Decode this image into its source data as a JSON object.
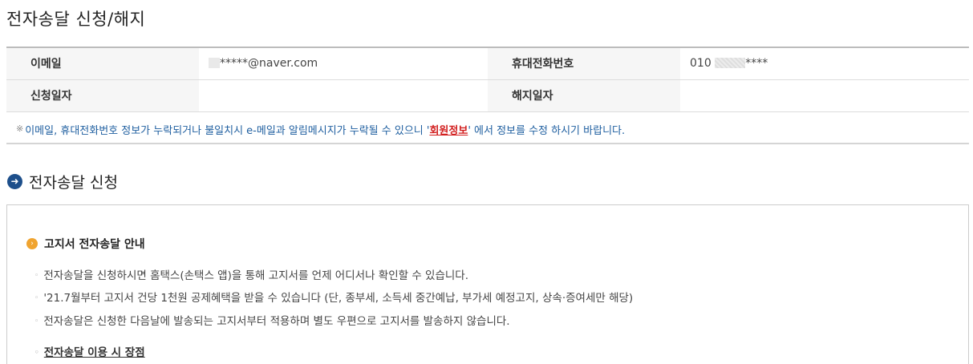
{
  "page": {
    "title": "전자송달 신청/해지"
  },
  "info": {
    "email_label": "이메일",
    "email_value": "*****@naver.com",
    "phone_label": "휴대전화번호",
    "phone_prefix": "010",
    "phone_suffix": "****",
    "apply_date_label": "신청일자",
    "apply_date_value": "",
    "cancel_date_label": "해지일자",
    "cancel_date_value": ""
  },
  "notice": {
    "mark": "※",
    "text_before": "이메일, 휴대전화번호 정보가 누락되거나 불일치시 e-메일과 알림메시지가 누락될 수 있으니 '",
    "link": "회원정보",
    "text_after": "' 에서 정보를 수정 하시기 바랍니다."
  },
  "section": {
    "title": "전자송달 신청"
  },
  "guide": {
    "title": "고지서 전자송달 안내",
    "items": [
      "전자송달을 신청하시면 홈택스(손택스 앱)을 통해 고지서를 언제 어디서나 확인할 수 있습니다.",
      "'21.7월부터 고지서 건당 1천원 공제혜택을 받을 수 있습니다 (단, 종부세, 소득세 중간예납, 부가세 예정고지, 상속·증여세만 해당)",
      "전자송달은 신청한 다음날에 발송되는 고지서부터 적용하며 별도 우편으로 고지서를 발송하지 않습니다."
    ],
    "benefit_link": "전자송달 이용 시 장점"
  },
  "colors": {
    "accent": "#1d4f8b",
    "notice_text": "#1f5fa0",
    "link_red": "#d21f1f",
    "guide_icon": "#f0a430"
  }
}
